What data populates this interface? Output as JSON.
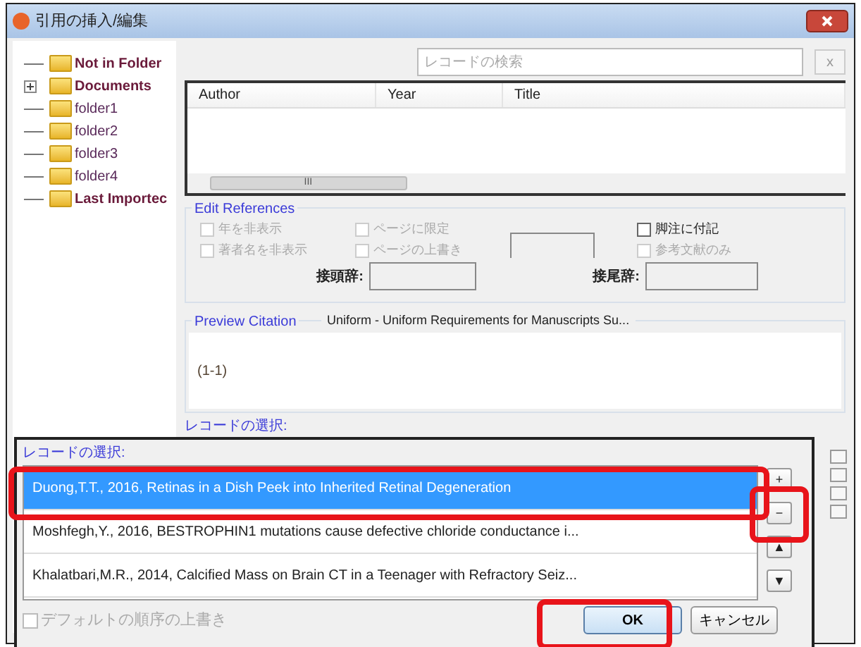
{
  "window": {
    "title": "引用の挿入/編集"
  },
  "folders": [
    {
      "label": "Not in Folder",
      "kind": "leaf"
    },
    {
      "label": "Documents",
      "kind": "collapsed"
    },
    {
      "label": "folder1",
      "kind": "leaf"
    },
    {
      "label": "folder2",
      "kind": "leaf"
    },
    {
      "label": "folder3",
      "kind": "leaf"
    },
    {
      "label": "folder4",
      "kind": "leaf"
    },
    {
      "label": "Last Importec",
      "kind": "leaf"
    }
  ],
  "search": {
    "placeholder": "レコードの検索",
    "clear": "x"
  },
  "table": {
    "columns": [
      "Author",
      "Year",
      "Title"
    ],
    "scroll_mark": "III"
  },
  "edit_references": {
    "title": "Edit References",
    "checkboxes": [
      {
        "label": "年を非表示",
        "checked": false,
        "disabled": true
      },
      {
        "label": "著者名を非表示",
        "checked": false,
        "disabled": true
      },
      {
        "label": "ページに限定",
        "checked": false,
        "disabled": true
      },
      {
        "label": "ページの上書き",
        "checked": false,
        "disabled": true
      },
      {
        "label": "脚注に付記",
        "checked": false,
        "disabled": false
      },
      {
        "label": "参考文献のみ",
        "checked": false,
        "disabled": true
      }
    ],
    "prefix_label": "接頭辞:",
    "suffix_label": "接尾辞:"
  },
  "preview": {
    "title": "Preview Citation",
    "style": "Uniform - Uniform Requirements for Manuscripts Su...",
    "text": "(1-1)"
  },
  "records_label_behind": "レコードの選択:",
  "records_dialog": {
    "label": "レコードの選択:",
    "items": [
      {
        "text": "Duong,T.T., 2016, Retinas in a Dish Peek into Inherited Retinal Degeneration",
        "selected": true
      },
      {
        "text": "Moshfegh,Y., 2016, BESTROPHIN1 mutations cause defective chloride conductance i...",
        "selected": false
      },
      {
        "text": "Khalatbari,M.R., 2014, Calcified Mass on Brain CT in a Teenager with Refractory Seiz...",
        "selected": false
      }
    ],
    "add": "+",
    "remove": "−",
    "up": "▲",
    "down": "▼",
    "override": {
      "label": "デフォルトの順序の上書き",
      "checked": false
    },
    "ok": "OK",
    "cancel": "キャンセル"
  }
}
